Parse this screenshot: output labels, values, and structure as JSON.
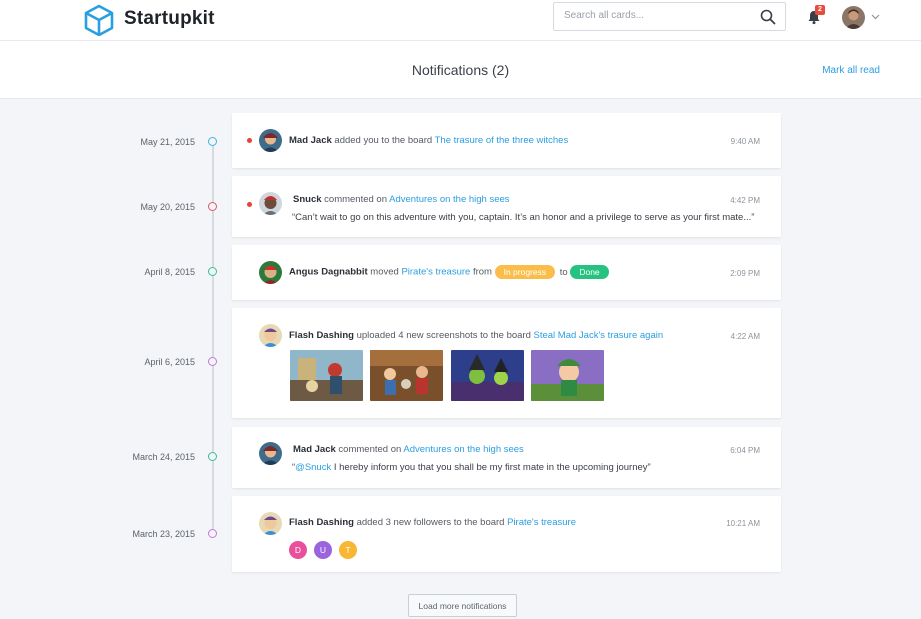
{
  "app": {
    "name": "Startupkit"
  },
  "search": {
    "placeholder": "Search all cards..."
  },
  "header": {
    "notification_count": "2",
    "title": "Notifications (2)",
    "mark_all_read": "Mark all read"
  },
  "colors": {
    "accent": "#2a9fe0",
    "unread": "#e8403a",
    "in_progress": "#fbbd4a",
    "done": "#26c281"
  },
  "notifications": [
    {
      "date": "May 21, 2015",
      "user": "Mad Jack",
      "action": "added you to the board",
      "target": "The trasure of the three witches",
      "time": "9:40 AM"
    },
    {
      "date": "May 20, 2015",
      "user": "Snuck",
      "action": "commented on",
      "target": "Adventures on the high sees",
      "time": "4:42 PM",
      "comment": "“Can’t wait to go on this adventure with you, captain. It’s an honor and a privilege to serve as your first mate...”"
    },
    {
      "date": "April 8, 2015",
      "user": "Angus Dagnabbit",
      "action": "moved",
      "target": "Pirate's treasure",
      "from_word": "from",
      "from_status": "In progress",
      "to_word": "to",
      "to_status": "Done",
      "time": "2:09 PM"
    },
    {
      "date": "April 6, 2015",
      "user": "Flash Dashing",
      "action": "uploaded 4 new screenshots to the board",
      "target": "Steal Mad Jack's trasure again",
      "time": "4:22 AM"
    },
    {
      "date": "March 24, 2015",
      "user": "Mad Jack",
      "action": "commented on",
      "target": "Adventures on the high sees",
      "time": "6:04 PM",
      "mention": "@Snuck",
      "comment_rest": " I hereby inform you that you shall be my first mate in the upcoming journey”"
    },
    {
      "date": "March 23, 2015",
      "user": "Flash Dashing",
      "action": "added 3 new followers to the board",
      "target": "Pirate's treasure",
      "time": "10:21 AM",
      "followers": [
        "D",
        "U",
        "T"
      ]
    }
  ],
  "load_more": "Load more notifications"
}
